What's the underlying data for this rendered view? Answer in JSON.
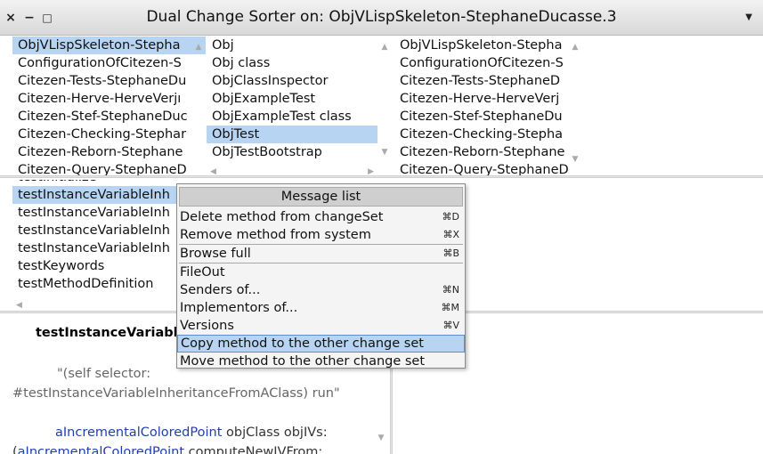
{
  "window": {
    "title": "Dual Change Sorter on: ObjVLispSkeleton-StephaneDucasse.3",
    "close_glyph": "×",
    "minimize_glyph": "−",
    "maximize_glyph": "□",
    "menu_glyph": "▼"
  },
  "left_changesets": {
    "items": [
      "ObjVLispSkeleton-Stepha",
      "ConfigurationOfCitezen-S",
      "Citezen-Tests-StephaneDu",
      "Citezen-Herve-HerveVerjı",
      "Citezen-Stef-StephaneDuc",
      "Citezen-Checking-Stephar",
      "Citezen-Reborn-Stephane",
      "Citezen-Query-StephaneD"
    ],
    "selected_index": 0
  },
  "classes": {
    "items": [
      "Obj",
      "Obj class",
      "ObjClassInspector",
      "ObjExampleTest",
      "ObjExampleTest class",
      "ObjTest",
      "ObjTestBootstrap"
    ],
    "selected_index": 5
  },
  "right_changesets": {
    "items": [
      "ObjVLispSkeleton-Stepha",
      "ConfigurationOfCitezen-S",
      "Citezen-Tests-StephaneD",
      "Citezen-Herve-HerveVerj",
      "Citezen-Stef-StephaneDu",
      "Citezen-Checking-Stepha",
      "Citezen-Reborn-Stephane",
      "Citezen-Query-StephaneD"
    ]
  },
  "methods": {
    "items": [
      "testInitialize",
      "testInstanceVariableInh",
      "testInstanceVariableInh",
      "testInstanceVariableInh",
      "testInstanceVariableInh",
      "testKeywords",
      "testMethodDefinition"
    ],
    "selected_index": 1
  },
  "code": {
    "signature": "testInstanceVariabl",
    "comment_line1": "\"(self  selector:",
    "comment_line2": "#testInstanceVariableInheritanceFromAClass) run\"",
    "line3_var": "aIncrementalColoredPoint",
    "line3_rest": " objClass objIVs:",
    "line4_open": "(",
    "line4_var": "aIncrementalColoredPoint",
    "line4_rest": " computeNewIVFrom:"
  },
  "context_menu": {
    "title": "Message list",
    "items": [
      {
        "label": "Delete method from changeSet",
        "shortcut": "⌘D"
      },
      {
        "label": "Remove method from system",
        "shortcut": "⌘X"
      },
      {
        "label": "Browse full",
        "shortcut": "⌘B"
      },
      {
        "label": "FileOut",
        "shortcut": ""
      },
      {
        "label": "Senders of...",
        "shortcut": "⌘N"
      },
      {
        "label": "Implementors of...",
        "shortcut": "⌘M"
      },
      {
        "label": "Versions",
        "shortcut": "⌘V"
      },
      {
        "label": "Copy method to the other change set",
        "shortcut": ""
      },
      {
        "label": "Move method to the other change set",
        "shortcut": ""
      }
    ],
    "highlighted_index": 7
  },
  "colors": {
    "selection": "#b7d5f2",
    "highlight_border": "#5a8fd0",
    "code_var": "#1f3fb0"
  }
}
